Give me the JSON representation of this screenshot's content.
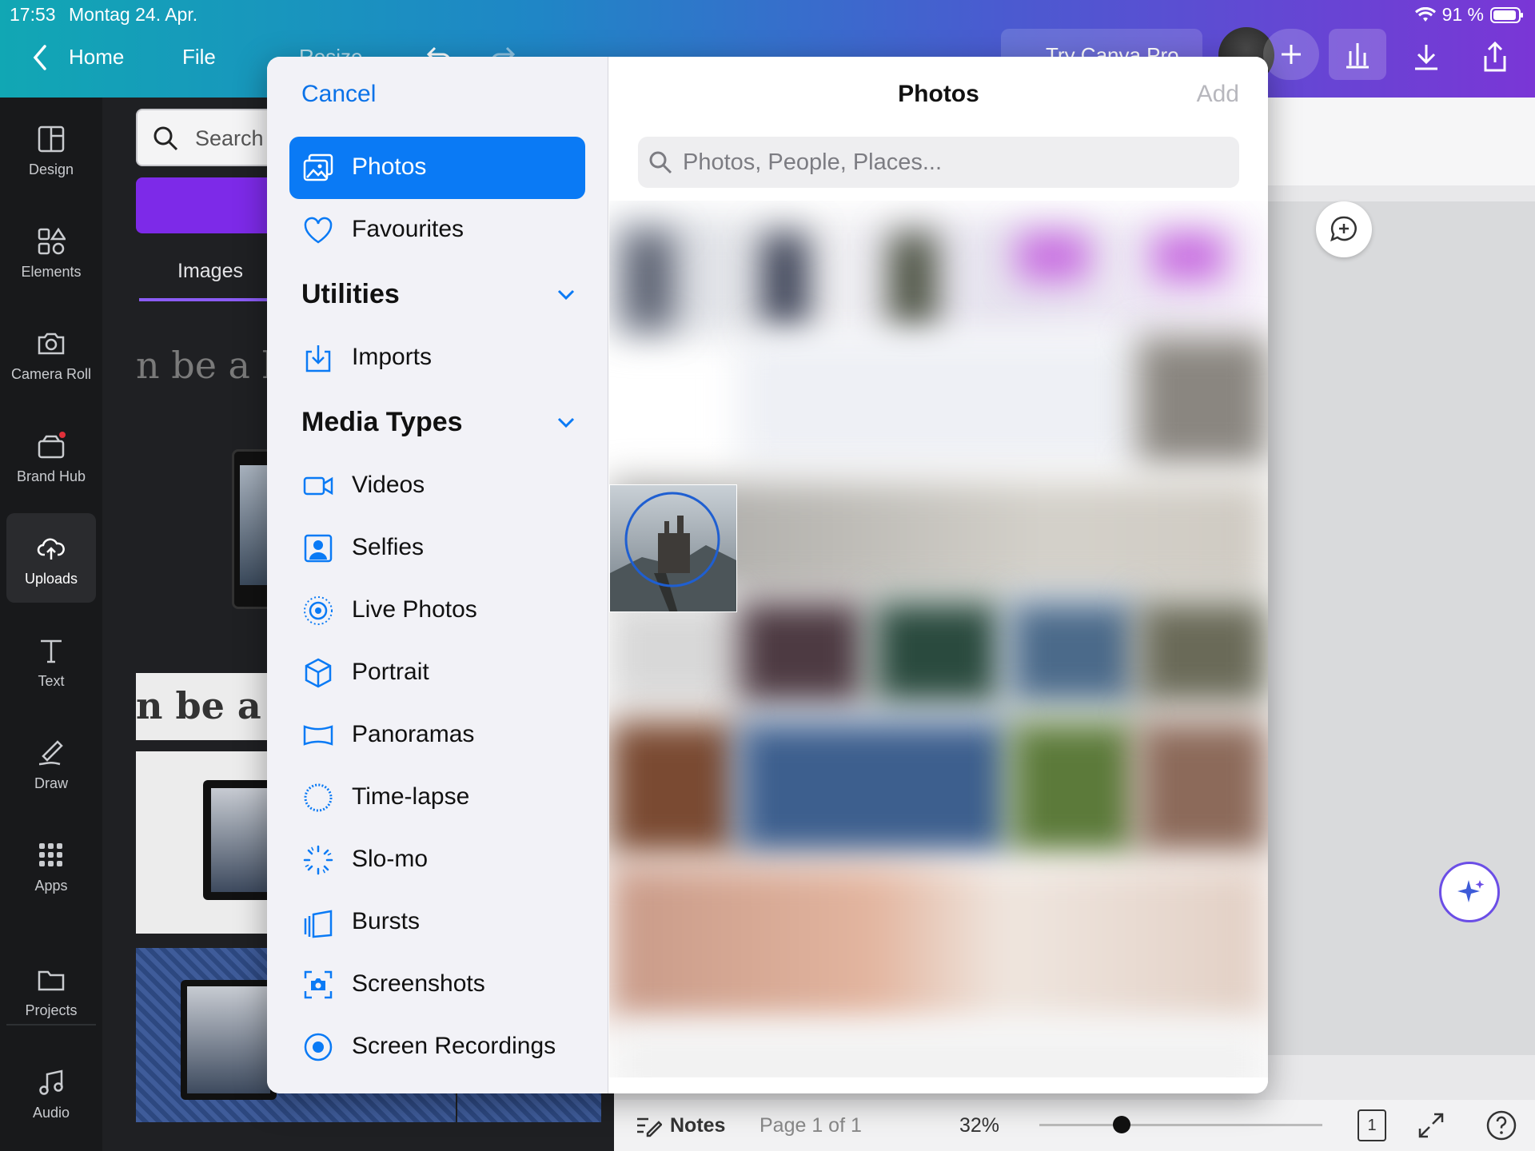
{
  "status": {
    "time": "17:53",
    "date": "Montag 24. Apr.",
    "battery": "91 %"
  },
  "nav": {
    "home": "Home",
    "file": "File",
    "resize": "Resize",
    "pro": "Try Canva Pro"
  },
  "sidebar": {
    "items": [
      {
        "label": "Design",
        "icon": "design-icon"
      },
      {
        "label": "Elements",
        "icon": "elements-icon"
      },
      {
        "label": "Camera Roll",
        "icon": "camera-icon"
      },
      {
        "label": "Brand Hub",
        "icon": "brand-hub-icon"
      },
      {
        "label": "Uploads",
        "icon": "upload-cloud-icon"
      },
      {
        "label": "Text",
        "icon": "text-icon"
      },
      {
        "label": "Draw",
        "icon": "draw-icon"
      },
      {
        "label": "Apps",
        "icon": "apps-grid-icon"
      },
      {
        "label": "Projects",
        "icon": "folder-icon"
      },
      {
        "label": "Audio",
        "icon": "music-note-icon"
      }
    ]
  },
  "panel": {
    "search_placeholder": "Search u",
    "tab": "Images",
    "snippet": "n be a k"
  },
  "bottom": {
    "notes": "Notes",
    "page": "Page 1 of 1",
    "zoom": "32%",
    "page_num": "1"
  },
  "modal": {
    "cancel": "Cancel",
    "title": "Photos",
    "add": "Add",
    "search_placeholder": "Photos, People, Places...",
    "top_items": [
      {
        "label": "Photos",
        "icon": "photos-icon",
        "selected": true
      },
      {
        "label": "Favourites",
        "icon": "heart-icon",
        "selected": false
      }
    ],
    "utilities_title": "Utilities",
    "utilities": [
      {
        "label": "Imports",
        "icon": "import-icon"
      }
    ],
    "media_types_title": "Media Types",
    "media_types": [
      {
        "label": "Videos",
        "icon": "video-icon"
      },
      {
        "label": "Selfies",
        "icon": "selfie-icon"
      },
      {
        "label": "Live Photos",
        "icon": "live-photo-icon"
      },
      {
        "label": "Portrait",
        "icon": "portrait-cube-icon"
      },
      {
        "label": "Panoramas",
        "icon": "panorama-icon"
      },
      {
        "label": "Time-lapse",
        "icon": "timelapse-icon"
      },
      {
        "label": "Slo-mo",
        "icon": "slomo-icon"
      },
      {
        "label": "Bursts",
        "icon": "bursts-icon"
      },
      {
        "label": "Screenshots",
        "icon": "screenshot-icon"
      },
      {
        "label": "Screen Recordings",
        "icon": "screen-recording-icon"
      }
    ]
  },
  "colors": {
    "accent": "#0a7af5",
    "canva_purple": "#7d2ae8"
  }
}
